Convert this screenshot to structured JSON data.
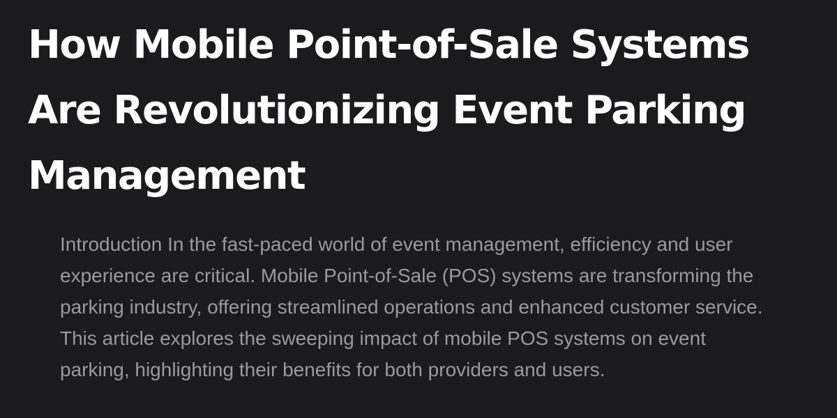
{
  "article": {
    "title": "How Mobile Point-of-Sale Systems Are Revolutionizing Event Parking Management",
    "intro": "Introduction In the fast-paced world of event management, efficiency and user experience are critical. Mobile Point-of-Sale (POS) systems are transforming the parking industry, offering streamlined operations and enhanced customer service. This article explores the sweeping impact of mobile POS systems on event parking, highlighting their benefits for both providers and users."
  },
  "colors": {
    "background": "#1b1b1d",
    "title": "#ffffff",
    "intro_text": "#9a9a9e"
  }
}
